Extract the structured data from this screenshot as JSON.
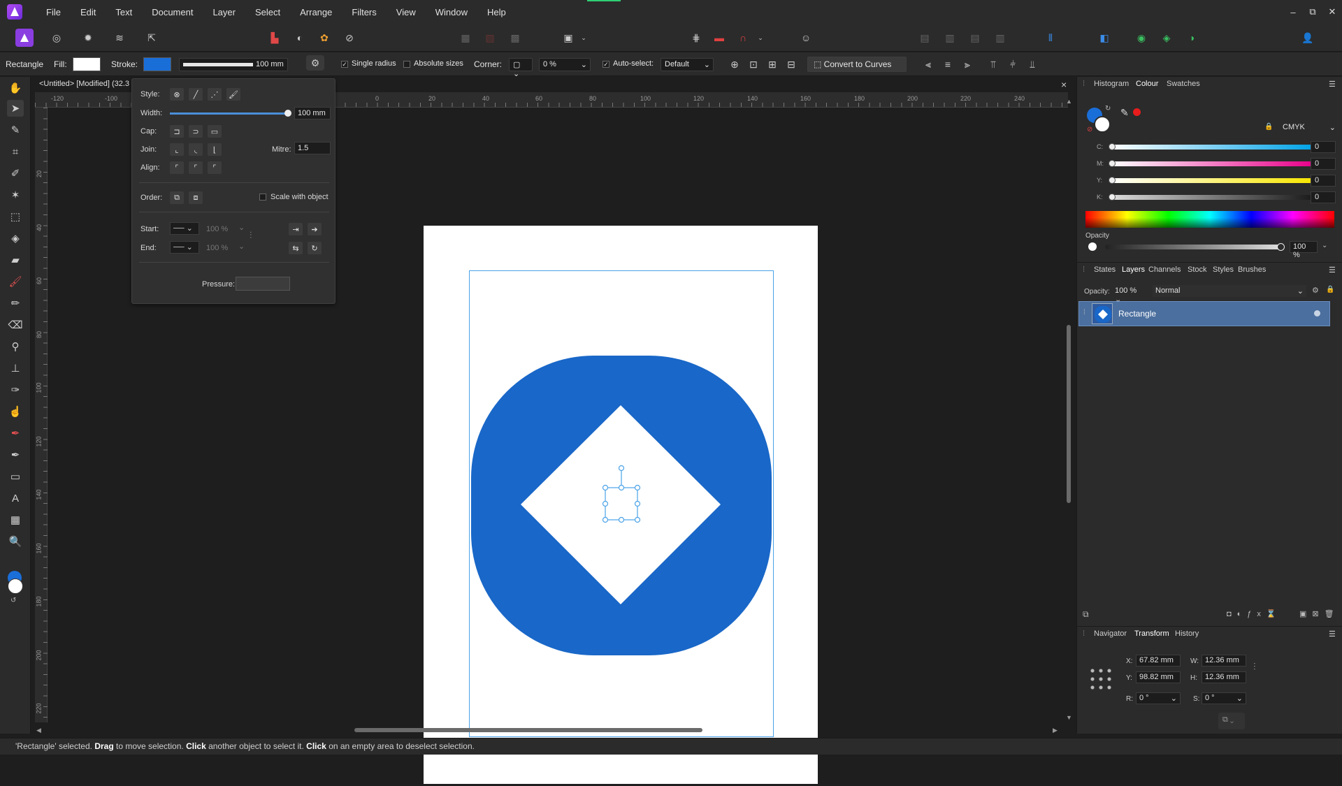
{
  "menu": {
    "items": [
      "File",
      "Edit",
      "Text",
      "Document",
      "Layer",
      "Select",
      "Arrange",
      "Filters",
      "View",
      "Window",
      "Help"
    ],
    "window_controls": [
      "–",
      "⧉",
      "✕"
    ]
  },
  "context": {
    "tool_name": "Rectangle",
    "fill_label": "Fill:",
    "stroke_label": "Stroke:",
    "stroke_width": "100 mm",
    "single_radius": "Single radius",
    "absolute_sizes": "Absolute sizes",
    "corner_label": "Corner:",
    "corner_value": "0 %",
    "auto_select": "Auto-select:",
    "auto_select_value": "Default",
    "convert_to_curves": "Convert to Curves",
    "fill_color": "#ffffff",
    "stroke_color": "#1a6ed8"
  },
  "document": {
    "tab_title": "<Untitled> [Modified] (32.3",
    "close": "×"
  },
  "ruler": {
    "h_labels": [
      "-120",
      "-100",
      "0",
      "20",
      "40",
      "60",
      "80",
      "100",
      "120",
      "140",
      "160",
      "180",
      "200",
      "220",
      "240"
    ],
    "v_labels": [
      "20",
      "40",
      "60",
      "80",
      "100",
      "120",
      "140",
      "160",
      "180",
      "200",
      "220"
    ]
  },
  "stroke_panel": {
    "style_label": "Style:",
    "width_label": "Width:",
    "width_value": "100 mm",
    "cap_label": "Cap:",
    "join_label": "Join:",
    "mitre_label": "Mitre:",
    "mitre_value": "1.5",
    "align_label": "Align:",
    "order_label": "Order:",
    "scale_with_object": "Scale with object",
    "start_label": "Start:",
    "end_label": "End:",
    "start_pct": "100 %",
    "end_pct": "100 %",
    "pressure_label": "Pressure:"
  },
  "colour_panel": {
    "tabs": [
      "Histogram",
      "Colour",
      "Swatches"
    ],
    "active_tab": "Colour",
    "model": "CMYK",
    "sliders": [
      {
        "letter": "C:",
        "value": "0"
      },
      {
        "letter": "M:",
        "value": "0"
      },
      {
        "letter": "Y:",
        "value": "0"
      },
      {
        "letter": "K:",
        "value": "0"
      }
    ],
    "opacity_label": "Opacity",
    "opacity_value": "100 %"
  },
  "layers_panel": {
    "tabs": [
      "States",
      "Layers",
      "Channels",
      "Stock",
      "Styles",
      "Brushes"
    ],
    "active_tab": "Layers",
    "opacity_label": "Opacity:",
    "opacity_value": "100 %",
    "blend_mode": "Normal",
    "layer_name": "Rectangle"
  },
  "transform_panel": {
    "tabs": [
      "Navigator",
      "Transform",
      "History"
    ],
    "active_tab": "Transform",
    "x_label": "X:",
    "x_value": "67.82 mm",
    "y_label": "Y:",
    "y_value": "98.82 mm",
    "w_label": "W:",
    "w_value": "12.36 mm",
    "h_label": "H:",
    "h_value": "12.36 mm",
    "r_label": "R:",
    "r_value": "0 °",
    "s_label": "S:",
    "s_value": "0 °"
  },
  "status": {
    "part1": "'Rectangle' selected. ",
    "drag": "Drag",
    "part2": " to move selection. ",
    "click1": "Click",
    "part3": " another object to select it. ",
    "click2": "Click",
    "part4": " on an empty area to deselect selection."
  },
  "artwork": {
    "blue": "#1967c8"
  }
}
